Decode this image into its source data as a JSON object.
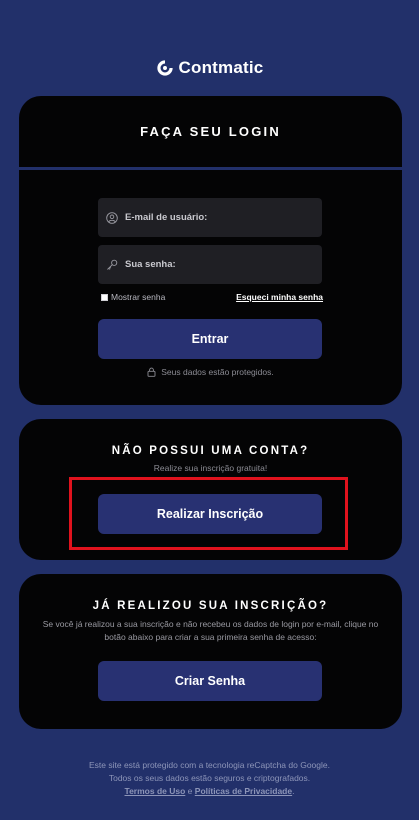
{
  "brand": {
    "name": "Contmatic"
  },
  "login": {
    "title": "FAÇA SEU LOGIN",
    "email_placeholder": "E-mail de usuário:",
    "password_placeholder": "Sua senha:",
    "show_password_label": "Mostrar senha",
    "forgot_password_link": "Esqueci minha senha",
    "submit_label": "Entrar",
    "security_note": "Seus dados estão protegidos."
  },
  "signup": {
    "title": "NÃO POSSUI UMA CONTA?",
    "subtitle": "Realize sua inscrição gratuita!",
    "button_label": "Realizar Inscrição"
  },
  "create_password": {
    "title": "JÁ REALIZOU SUA INSCRIÇÃO?",
    "description": "Se você já realizou a sua inscrição e não recebeu os dados de login por e-mail, clique no botão abaixo para criar a sua primeira senha de acesso:",
    "button_label": "Criar Senha"
  },
  "footer": {
    "line1": "Este site está protegido com a tecnologia reCaptcha do Google.",
    "line2": "Todos os seus dados estão seguros e criptografados.",
    "terms_link": "Termos de Uso",
    "conjunction": "e",
    "privacy_link": "Políticas de Privacidade",
    "period": "."
  },
  "icons": {
    "logo": "contmatic-logo-icon",
    "email": "user-icon",
    "password": "key-icon",
    "security": "lock-icon"
  },
  "colors": {
    "background": "#22306a",
    "card": "#040405",
    "button": "#283172",
    "field": "#1f1f24",
    "highlight": "#e0121d"
  }
}
